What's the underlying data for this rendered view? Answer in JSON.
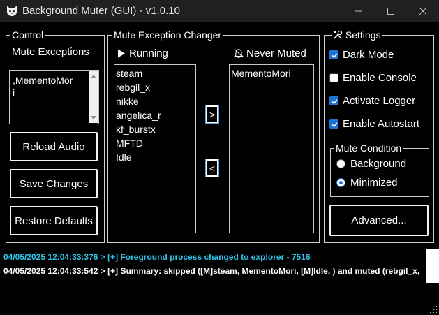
{
  "window": {
    "title": "Background Muter (GUI) - v1.0.10",
    "icon": "cat-icon"
  },
  "control": {
    "legend": "Control",
    "mute_exceptions_label": "Mute Exceptions",
    "mute_exceptions_line1": ",MementoMor",
    "mute_exceptions_line2": "i",
    "reload_audio": "Reload Audio",
    "save_changes": "Save Changes",
    "restore_defaults": "Restore Defaults"
  },
  "changer": {
    "legend": "Mute Exception Changer",
    "running_label": "Running",
    "never_muted_label": "Never Muted",
    "running_items": [
      "steam",
      "rebgil_x",
      "nikke",
      "angelica_r",
      "kf_burstx",
      "MFTD",
      "Idle"
    ],
    "never_muted_items": [
      "MementoMori"
    ],
    "move_right": ">",
    "move_left": "<"
  },
  "settings": {
    "legend": "Settings",
    "dark_mode": {
      "label": "Dark Mode",
      "checked": true
    },
    "enable_console": {
      "label": "Enable Console",
      "checked": false
    },
    "activate_logger": {
      "label": "Activate Logger",
      "checked": true
    },
    "enable_autostart": {
      "label": "Enable Autostart",
      "checked": true
    },
    "mute_condition": {
      "legend": "Mute Condition",
      "background": "Background",
      "minimized": "Minimized",
      "selected": "Minimized"
    },
    "advanced": "Advanced..."
  },
  "log": {
    "lines": [
      {
        "text": "04/05/2025 12:04:33:376 > [+] Foreground process changed to explorer - 7516",
        "color": "#2ec4e8"
      },
      {
        "text": "04/05/2025 12:04:33:542 > [+] Summary: skipped ([M]steam, MementoMori, [M]Idle, ) and muted (rebgil_x,",
        "color": "#ffffff"
      }
    ]
  },
  "colors": {
    "accent": "#1e73d8",
    "log_info": "#2ec4e8"
  }
}
